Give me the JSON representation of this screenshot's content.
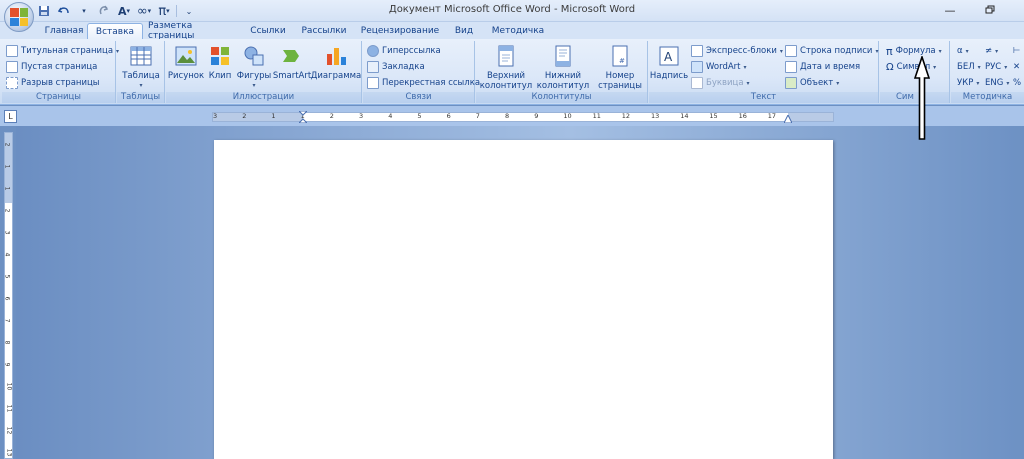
{
  "window": {
    "title": "Документ Microsoft Office Word - Microsoft Word",
    "minimize_icon": "minimize-icon",
    "restore_icon": "restore-icon"
  },
  "quick_access": {
    "save_icon": "save-icon",
    "undo_icon": "undo-icon",
    "redo_icon": "redo-icon",
    "text_style_icon": "text-style-icon",
    "infinity_icon": "infinity-icon",
    "pi_icon": "pi-icon",
    "customize_icon": "customize-icon"
  },
  "tabs": [
    {
      "label": "Главная"
    },
    {
      "label": "Вставка"
    },
    {
      "label": "Разметка страницы"
    },
    {
      "label": "Ссылки"
    },
    {
      "label": "Рассылки"
    },
    {
      "label": "Рецензирование"
    },
    {
      "label": "Вид"
    },
    {
      "label": "Методичка"
    }
  ],
  "active_tab": "Вставка",
  "ribbon": {
    "pages": {
      "label": "Страницы",
      "cover_page": "Титульная страница",
      "blank_page": "Пустая страница",
      "page_break": "Разрыв страницы"
    },
    "tables": {
      "label": "Таблицы",
      "table": "Таблица"
    },
    "illustrations": {
      "label": "Иллюстрации",
      "picture": "Рисунок",
      "clip": "Клип",
      "shapes": "Фигуры",
      "smartart": "SmartArt",
      "chart": "Диаграмма"
    },
    "links": {
      "label": "Связи",
      "hyperlink": "Гиперссылка",
      "bookmark": "Закладка",
      "cross_reference": "Перекрестная ссылка"
    },
    "header_footer": {
      "label": "Колонтитулы",
      "header_line1": "Верхний",
      "header_line2": "колонтитул",
      "footer_line1": "Нижний",
      "footer_line2": "колонтитул",
      "page_number_line1": "Номер",
      "page_number_line2": "страницы"
    },
    "text": {
      "label": "Текст",
      "text_box": "Надпись",
      "quick_parts": "Экспресс-блоки",
      "wordart": "WordArt",
      "drop_cap": "Буквица",
      "signature_line": "Строка подписи",
      "date_time": "Дата и время",
      "object": "Объект"
    },
    "symbols": {
      "label": "Сим",
      "equation": "Формула",
      "symbol": "Символ"
    },
    "methodichka": {
      "label": "Методичка",
      "alpha": "α",
      "neq": "≠",
      "bel": "БЕЛ",
      "rus": "РУС",
      "ukr": "УКР",
      "eng": "ENG",
      "percent": "%"
    }
  },
  "ruler": {
    "numbers": [
      "3",
      "2",
      "1",
      "1",
      "2",
      "3",
      "4",
      "5",
      "6",
      "7",
      "8",
      "9",
      "10",
      "11",
      "12",
      "13",
      "14",
      "15",
      "16",
      "17"
    ],
    "vnumbers": [
      "2",
      "1",
      "1",
      "2",
      "3",
      "4",
      "5",
      "6",
      "7",
      "8",
      "9",
      "10",
      "11",
      "12",
      "13"
    ]
  },
  "annotation": {
    "arrow_icon": "up-arrow-icon"
  }
}
